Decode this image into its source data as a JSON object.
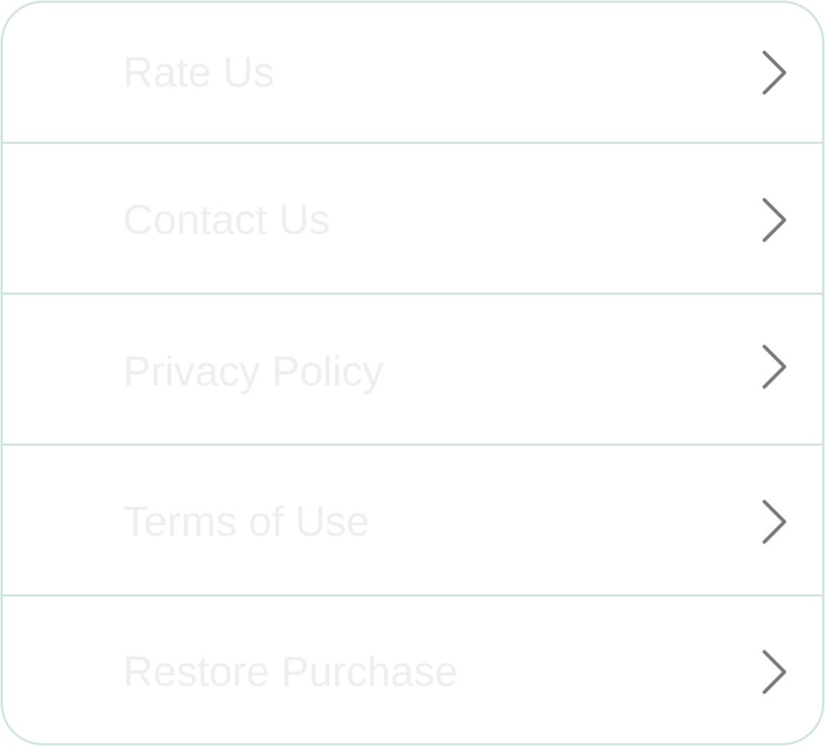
{
  "settings_list": {
    "items": [
      {
        "label": "Rate Us",
        "icon": "chevron-right-icon"
      },
      {
        "label": "Contact Us",
        "icon": "chevron-right-icon"
      },
      {
        "label": "Privacy Policy",
        "icon": "chevron-right-icon"
      },
      {
        "label": "Terms of Use",
        "icon": "chevron-right-icon"
      },
      {
        "label": "Restore Purchase",
        "icon": "chevron-right-icon"
      }
    ],
    "colors": {
      "border": "#cce2dc",
      "label": "#eeeeee",
      "chevron": "#777777",
      "background": "#ffffff"
    }
  }
}
